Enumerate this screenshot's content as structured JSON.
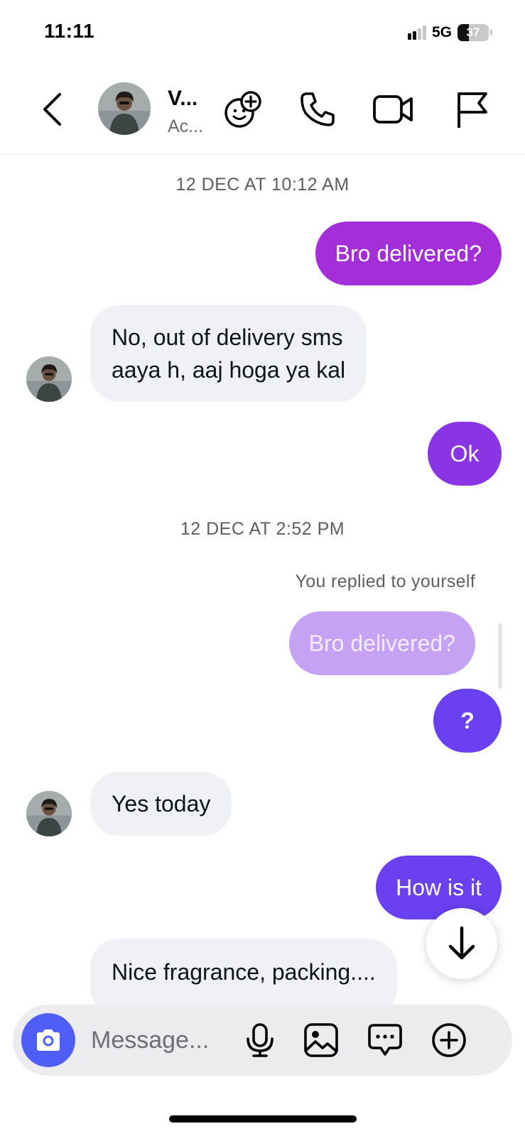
{
  "status_bar": {
    "time": "11:11",
    "network": "5G",
    "battery": "37",
    "battery_fraction": 0.37
  },
  "header": {
    "contact_name": "V...",
    "contact_subtitle": "Ac...",
    "icons": {
      "back": "chevron-left-icon",
      "effects": "sticker-add-icon",
      "call": "phone-icon",
      "video": "video-camera-icon",
      "report": "flag-icon"
    }
  },
  "chat": {
    "timestamp_1": "12 DEC AT 10:12 AM",
    "msg_1": "Bro delivered?",
    "msg_2_line1": "No, out of delivery sms",
    "msg_2_line2": "aaya h, aaj hoga ya kal",
    "msg_3": "Ok",
    "timestamp_2": "12 DEC AT 2:52 PM",
    "replied_note": "You replied to yourself",
    "msg_quoted": "Bro delivered?",
    "msg_4": "?",
    "msg_5": "Yes today",
    "msg_6": "How is it",
    "msg_7": "Nice fragrance, packing...."
  },
  "composer": {
    "placeholder": "Message...",
    "icons": {
      "camera": "camera-icon",
      "mic": "microphone-icon",
      "gallery": "image-icon",
      "sticker": "chat-bubble-icon",
      "add": "plus-circle-icon"
    }
  },
  "colors": {
    "outgoing_1": "#a42fd8",
    "outgoing_2": "#8a35e4",
    "outgoing_3": "#6a40f0",
    "incoming": "#eff1f4",
    "camera_button": "#4f5ef6"
  }
}
